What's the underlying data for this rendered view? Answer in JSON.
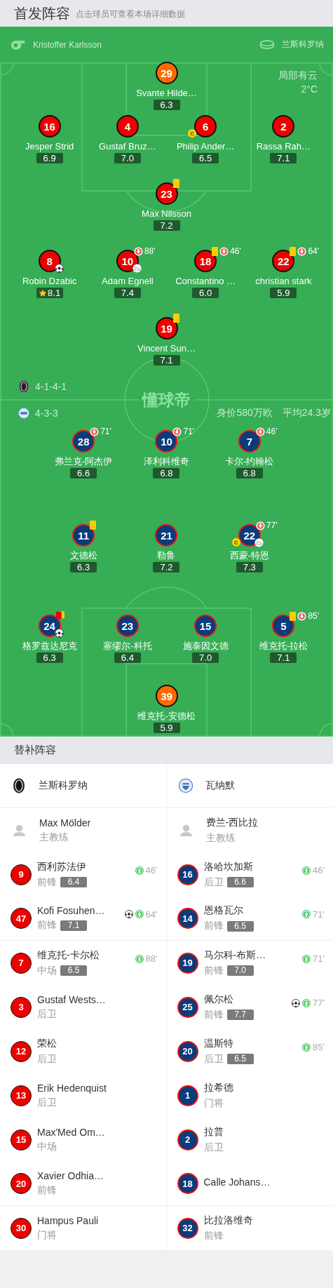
{
  "header": {
    "title": "首发阵容",
    "hint": "点击球员可查看本场详细数据"
  },
  "coach_bar": {
    "coach": "Kristoffer Karlsson",
    "venue": "兰斯科罗纳"
  },
  "weather": {
    "condition": "局部有云",
    "temperature": "2°C"
  },
  "brand": "懂球帝",
  "lineups": [
    {
      "color": "#ee0000",
      "formation": "4-1-4-1",
      "lines": [
        {
          "players": [
            {
              "number": "29",
              "name": "Svante Hilde…",
              "rating": "6.3",
              "kind": "goalkeeper"
            }
          ]
        },
        {
          "players": [
            {
              "number": "16",
              "name": "Jesper Strid",
              "rating": "6.9",
              "kind": "outfield"
            },
            {
              "number": "4",
              "name": "Gustaf Bruz…",
              "rating": "7.0",
              "kind": "outfield"
            },
            {
              "number": "6",
              "name": "Philip Ander…",
              "rating": "6.5",
              "kind": "outfield",
              "events": [
                {
                  "kind": "captain",
                  "label": "C"
                }
              ]
            },
            {
              "number": "2",
              "name": "Rassa Rah…",
              "rating": "7.1",
              "kind": "outfield"
            }
          ]
        },
        {
          "players": [
            {
              "number": "23",
              "name": "Max Nilsson",
              "rating": "7.2",
              "kind": "outfield",
              "events": [
                {
                  "kind": "yellow"
                }
              ]
            }
          ]
        },
        {
          "players": [
            {
              "number": "8",
              "name": "Robin Dzabic",
              "rating": "8.1",
              "kind": "outfield",
              "events": [
                {
                  "kind": "goal"
                },
                {
                  "kind": "mvp"
                }
              ]
            },
            {
              "number": "10",
              "name": "Adam Egnell",
              "rating": "7.4",
              "kind": "outfield",
              "events": [
                {
                  "kind": "sub_out",
                  "minute": "88'"
                },
                {
                  "kind": "assist"
                }
              ]
            },
            {
              "number": "18",
              "name": "Constantino …",
              "rating": "6.0",
              "kind": "outfield",
              "events": [
                {
                  "kind": "yellow"
                },
                {
                  "kind": "sub_out",
                  "minute": "46'"
                }
              ]
            },
            {
              "number": "22",
              "name": "christian stark",
              "rating": "5.9",
              "kind": "outfield",
              "events": [
                {
                  "kind": "yellow"
                },
                {
                  "kind": "sub_out",
                  "minute": "64'"
                }
              ]
            }
          ]
        },
        {
          "players": [
            {
              "number": "19",
              "name": "Vincent Sun…",
              "rating": "7.1",
              "kind": "outfield",
              "events": [
                {
                  "kind": "yellow"
                }
              ]
            }
          ]
        }
      ]
    },
    {
      "color": "#0a3b7c",
      "formation": "4-3-3",
      "value": "身价580万欧",
      "age": "平均24.3岁",
      "lines": [
        {
          "players": [
            {
              "number": "28",
              "name": "弗兰克-阿杰伊",
              "rating": "6.6",
              "kind": "outfield",
              "events": [
                {
                  "kind": "sub_out",
                  "minute": "71'"
                }
              ]
            },
            {
              "number": "10",
              "name": "泽利科维奇",
              "rating": "6.8",
              "kind": "outfield",
              "events": [
                {
                  "kind": "sub_out",
                  "minute": "71'"
                }
              ]
            },
            {
              "number": "7",
              "name": "卡尔-约翰松",
              "rating": "6.8",
              "kind": "outfield",
              "events": [
                {
                  "kind": "sub_out",
                  "minute": "46'"
                }
              ]
            }
          ]
        },
        {
          "players": [
            {
              "number": "11",
              "name": "文德松",
              "rating": "6.3",
              "kind": "outfield",
              "events": [
                {
                  "kind": "yellow"
                }
              ]
            },
            {
              "number": "21",
              "name": "勒鲁",
              "rating": "7.2",
              "kind": "outfield"
            },
            {
              "number": "22",
              "name": "西蒙-特恩",
              "rating": "7.3",
              "kind": "outfield",
              "events": [
                {
                  "kind": "sub_out",
                  "minute": "77'"
                },
                {
                  "kind": "captain",
                  "label": "C"
                },
                {
                  "kind": "assist"
                }
              ]
            }
          ]
        },
        {
          "players": [
            {
              "number": "24",
              "name": "格罗兹达尼克",
              "rating": "6.3",
              "kind": "outfield",
              "events": [
                {
                  "kind": "second_yellow"
                },
                {
                  "kind": "goal"
                }
              ]
            },
            {
              "number": "23",
              "name": "塞缪尔-科托",
              "rating": "6.4",
              "kind": "outfield"
            },
            {
              "number": "15",
              "name": "施泰因文德",
              "rating": "7.0",
              "kind": "outfield"
            },
            {
              "number": "5",
              "name": "维克托-拉松",
              "rating": "7.1",
              "kind": "outfield",
              "events": [
                {
                  "kind": "yellow"
                },
                {
                  "kind": "sub_out",
                  "minute": "85'"
                }
              ]
            }
          ]
        },
        {
          "players": [
            {
              "number": "39",
              "name": "维克托-安德松",
              "rating": "5.9",
              "kind": "goalkeeper"
            }
          ]
        }
      ]
    }
  ],
  "bench": {
    "title": "替补阵容",
    "teams": [
      {
        "name": "兰斯科罗纳",
        "coach": "Max Mölder",
        "coach_role": "主教练",
        "players": [
          {
            "number": "9",
            "name": "西利苏法伊",
            "position": "前锋",
            "rating": "6.4",
            "events": [
              {
                "kind": "sub_in",
                "minute": "46'"
              }
            ]
          },
          {
            "number": "47",
            "name": "Kofi Fosuhen…",
            "position": "前锋",
            "rating": "7.1",
            "events": [
              {
                "kind": "goal"
              },
              {
                "kind": "sub_in",
                "minute": "64'"
              }
            ]
          },
          {
            "number": "7",
            "name": "维克托-卡尔松",
            "position": "中场",
            "rating": "6.5",
            "events": [
              {
                "kind": "sub_in",
                "minute": "88'"
              }
            ]
          },
          {
            "number": "3",
            "name": "Gustaf Wests…",
            "position": "后卫"
          },
          {
            "number": "12",
            "name": "荣松",
            "position": "后卫"
          },
          {
            "number": "13",
            "name": "Erik Hedenquist",
            "position": "后卫"
          },
          {
            "number": "15",
            "name": "Max'Med Om…",
            "position": "中场"
          },
          {
            "number": "20",
            "name": "Xavier Odhia…",
            "position": "前锋"
          },
          {
            "number": "30",
            "name": "Hampus Pauli",
            "position": "门将"
          }
        ]
      },
      {
        "name": "瓦纳默",
        "coach": "费兰-西比拉",
        "coach_role": "主教练",
        "players": [
          {
            "number": "16",
            "name": "洛哈坎加斯",
            "position": "后卫",
            "rating": "6.6",
            "events": [
              {
                "kind": "sub_in",
                "minute": "46'"
              }
            ]
          },
          {
            "number": "14",
            "name": "恩格瓦尔",
            "position": "前锋",
            "rating": "6.5",
            "events": [
              {
                "kind": "sub_in",
                "minute": "71'"
              }
            ]
          },
          {
            "number": "19",
            "name": "马尔科-布斯…",
            "position": "前锋",
            "rating": "7.0",
            "events": [
              {
                "kind": "sub_in",
                "minute": "71'"
              }
            ]
          },
          {
            "number": "25",
            "name": "佩尔松",
            "position": "前锋",
            "rating": "7.7",
            "events": [
              {
                "kind": "goal"
              },
              {
                "kind": "sub_in",
                "minute": "77'"
              }
            ]
          },
          {
            "number": "20",
            "name": "温斯特",
            "position": "后卫",
            "rating": "6.5",
            "events": [
              {
                "kind": "sub_in",
                "minute": "85'"
              }
            ]
          },
          {
            "number": "1",
            "name": "拉希德",
            "position": "门将"
          },
          {
            "number": "2",
            "name": "拉普",
            "position": "后卫"
          },
          {
            "number": "18",
            "name": "Calle Johans…"
          },
          {
            "number": "32",
            "name": "比拉洛维奇",
            "position": "前锋"
          }
        ]
      }
    ]
  }
}
